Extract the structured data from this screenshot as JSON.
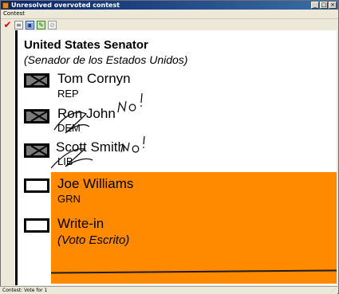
{
  "window": {
    "title": "Unresolved overvoted contest",
    "buttons": {
      "minimize": "_",
      "maximize": "□",
      "close": "×"
    }
  },
  "menu": {
    "items": [
      "Contest"
    ]
  },
  "toolbar": {
    "tools": [
      {
        "icon": "check-icon",
        "glyph": "✔"
      },
      {
        "icon": "page-icon",
        "glyph": "≡"
      },
      {
        "icon": "frame-icon",
        "glyph": "▣"
      },
      {
        "icon": "edit-icon",
        "glyph": "✎"
      },
      {
        "icon": "clear-icon",
        "glyph": "⊘"
      }
    ]
  },
  "ballot": {
    "contest_title": "United States Senator",
    "contest_subtitle": "(Senador de los Estados Unidos)",
    "candidates": [
      {
        "name": "Tom Cornyn",
        "party": "REP",
        "marked": true
      },
      {
        "name": "Ron John",
        "party": "DEM",
        "marked": true,
        "annotation": "NO!"
      },
      {
        "name": "Scott Smith",
        "party": "LIB",
        "marked": true,
        "annotation": "NO!"
      },
      {
        "name": "Joe Williams",
        "party": "GRN",
        "marked": false
      },
      {
        "name": "Write-in",
        "subtitle": "(Voto Escrito)",
        "marked": false
      }
    ],
    "highlight_color": "#ff8a00"
  },
  "status": {
    "text": "Contest: Vote for 1"
  }
}
